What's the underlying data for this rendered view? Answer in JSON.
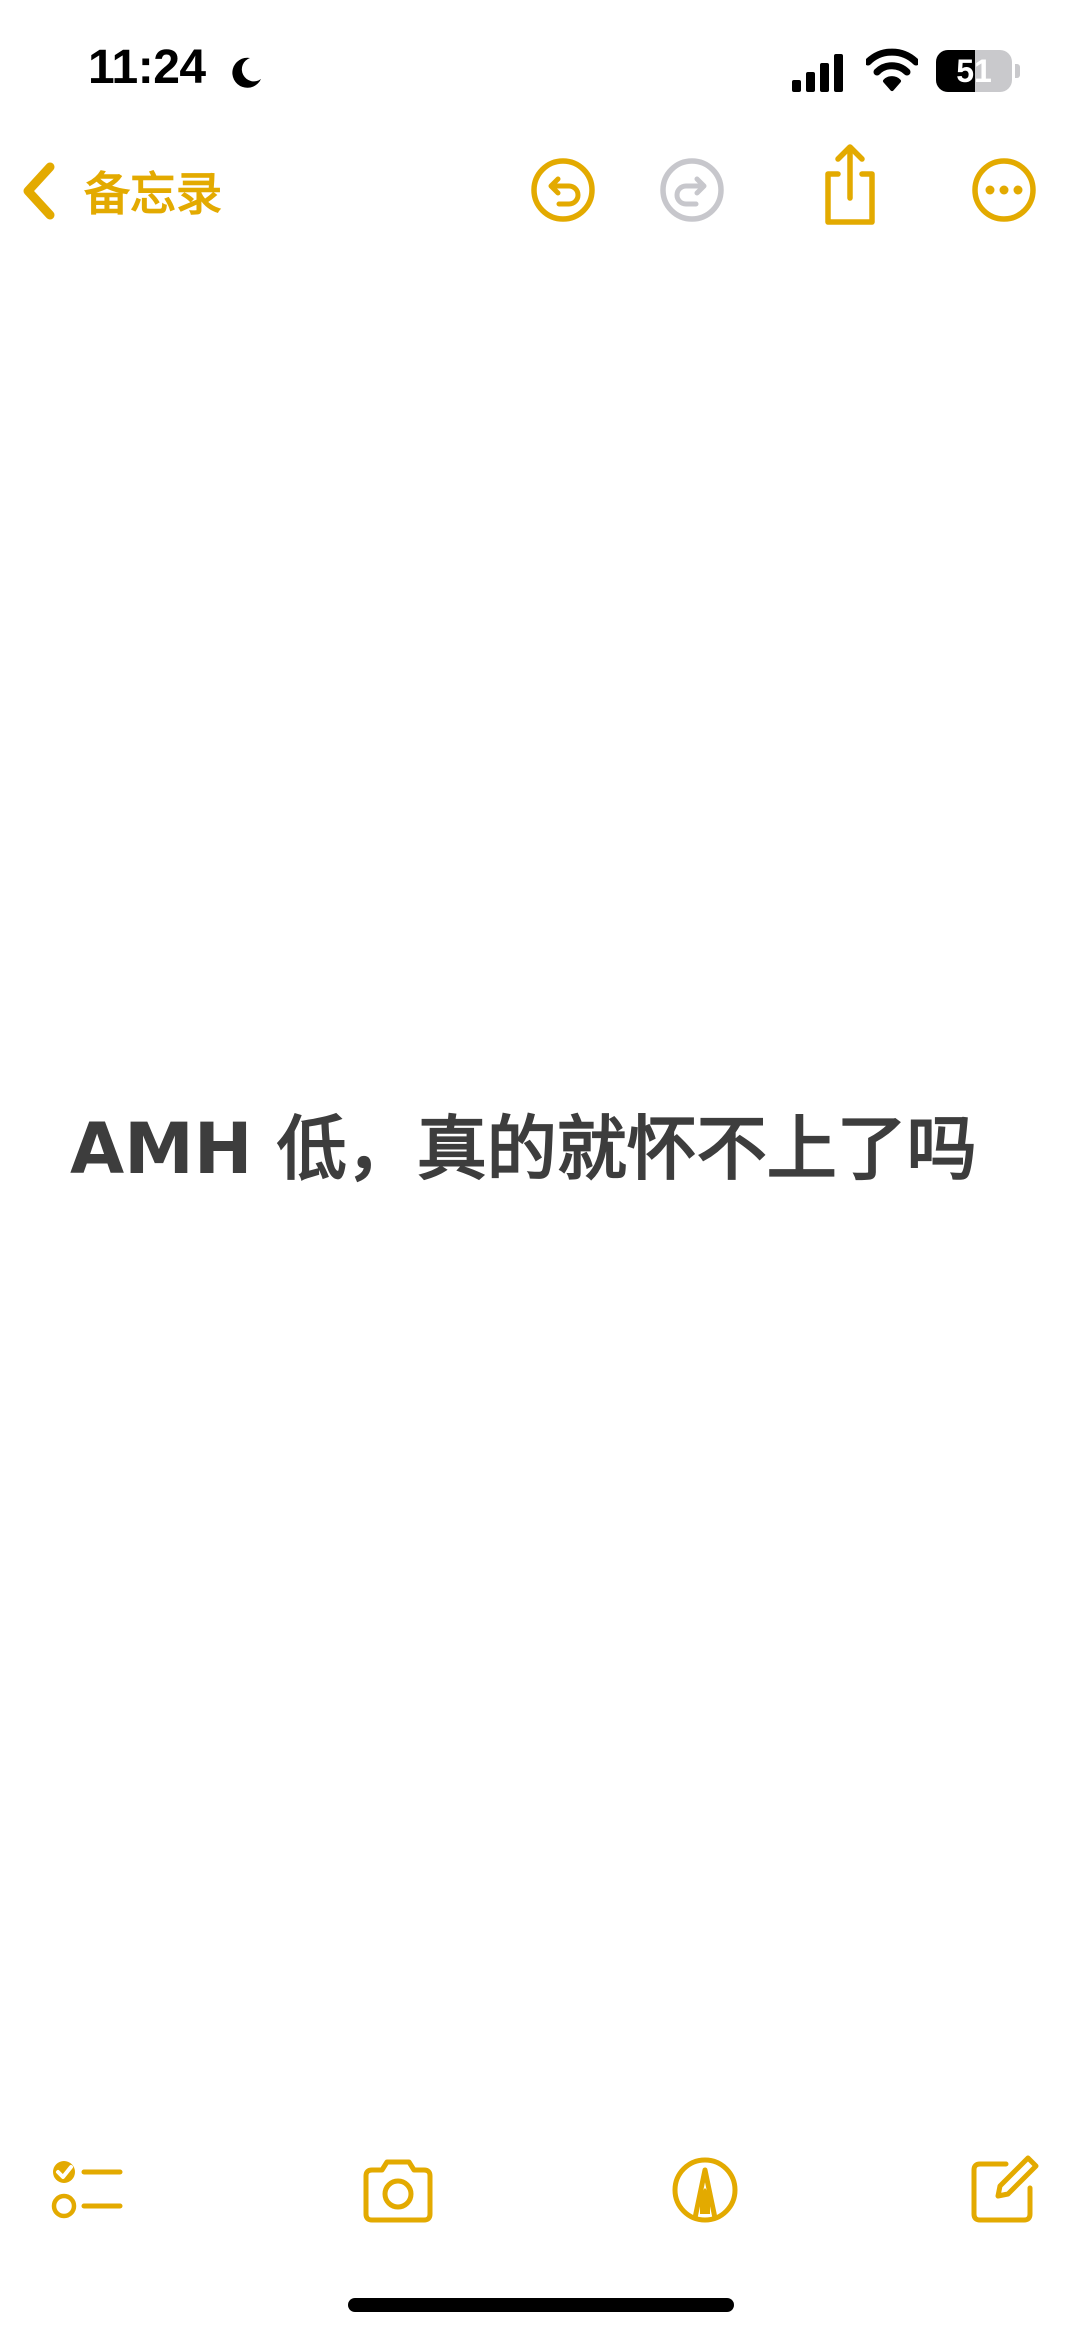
{
  "status_bar": {
    "time": "11:24",
    "battery_level": "51",
    "battery_fraction": 0.51,
    "icons": [
      "moon-icon",
      "cellular-signal-icon",
      "wifi-icon",
      "battery-icon"
    ]
  },
  "nav": {
    "back_label": "备忘录",
    "icons": [
      "chevron-left-icon",
      "undo-icon",
      "redo-icon",
      "share-icon",
      "more-icon"
    ],
    "redo_enabled": false
  },
  "note": {
    "text": "AMH 低，真的就怀不上了吗"
  },
  "toolbar": {
    "icons": [
      "checklist-icon",
      "camera-icon",
      "markup-icon",
      "compose-icon"
    ]
  },
  "colors": {
    "accent": "#e3aa00",
    "disabled": "#c7c7cc",
    "text": "#3d3d3d",
    "background": "#ffffff"
  }
}
